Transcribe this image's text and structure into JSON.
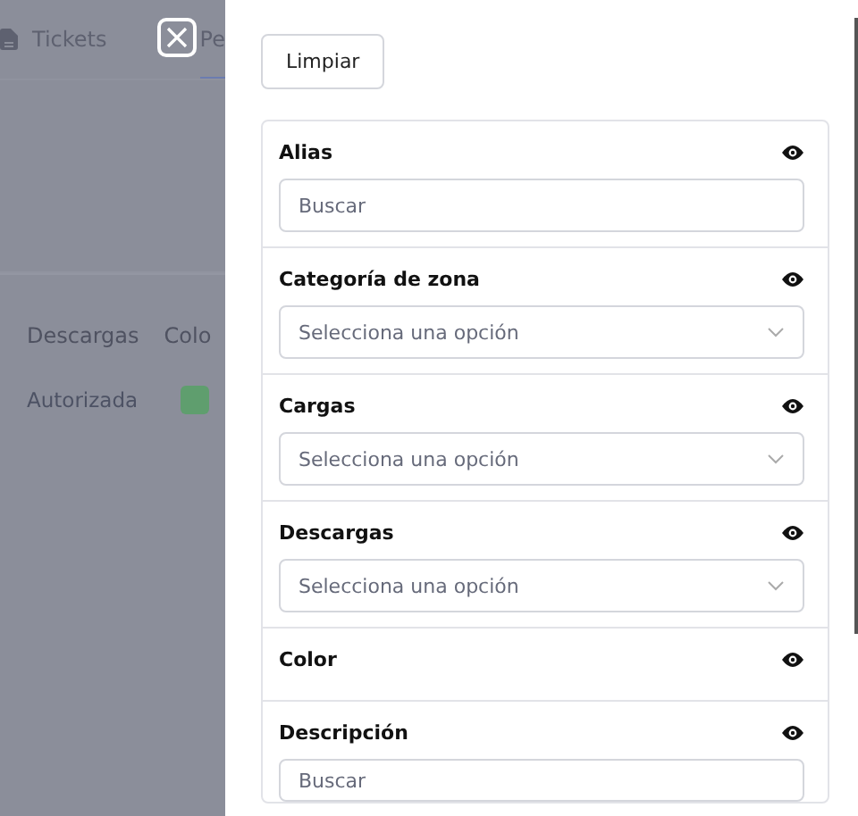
{
  "background": {
    "tabs": [
      {
        "label": "Tickets",
        "selected": false
      },
      {
        "label": "Pe",
        "selected": true
      }
    ],
    "table": {
      "columns": [
        "Descargas",
        "Colo"
      ],
      "rows": [
        {
          "status": "Autorizada",
          "color": "#5f9e6e"
        }
      ]
    }
  },
  "drawer": {
    "clear_button": "Limpiar",
    "filters": [
      {
        "kind": "text",
        "label": "Alias",
        "placeholder": "Buscar"
      },
      {
        "kind": "select",
        "label": "Categoría de zona",
        "placeholder": "Selecciona una opción"
      },
      {
        "kind": "select",
        "label": "Cargas",
        "placeholder": "Selecciona una opción"
      },
      {
        "kind": "select",
        "label": "Descargas",
        "placeholder": "Selecciona una opción"
      },
      {
        "kind": "none",
        "label": "Color"
      },
      {
        "kind": "text",
        "label": "Descripción",
        "placeholder": "Buscar"
      }
    ]
  }
}
